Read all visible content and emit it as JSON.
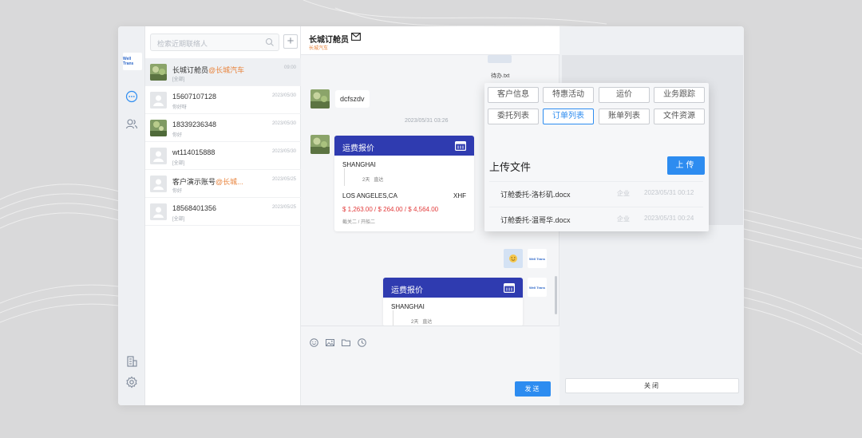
{
  "sidebar": {
    "logo_text": "Well Trans",
    "icons": [
      "chat-icon",
      "contacts-icon",
      "building-icon",
      "settings-icon"
    ]
  },
  "contacts": {
    "search_placeholder": "检索近期联络人",
    "add_label": "+",
    "items": [
      {
        "name": "长城订舱员",
        "org": "@长城汽车",
        "sub": "[全部]",
        "time": "09:00",
        "active": true,
        "photo": true
      },
      {
        "name": "15607107128",
        "org": "",
        "sub": "你好呀",
        "time": "2023/05/30",
        "active": false,
        "photo": false
      },
      {
        "name": "18339236348",
        "org": "",
        "sub": "你好",
        "time": "2023/05/30",
        "active": false,
        "photo": true
      },
      {
        "name": "wt114015888",
        "org": "",
        "sub": "[全部]",
        "time": "2023/05/30",
        "active": false,
        "photo": false
      },
      {
        "name": "客户演示账号",
        "org": "@长城...",
        "sub": "你好",
        "time": "2023/05/25",
        "active": false,
        "photo": false
      },
      {
        "name": "18568401356",
        "org": "",
        "sub": "[全部]",
        "time": "2023/05/25",
        "active": false,
        "photo": false
      }
    ]
  },
  "chat": {
    "title": "长城订舱员",
    "org": "长城汽车",
    "file_name": "待办.txt",
    "text_message": "dcfszdv",
    "timestamp": "2023/05/31 03:26",
    "quote1": {
      "header": "运费报价",
      "pol": "SHANGHAI",
      "transit": "2天",
      "route": "直达",
      "pod": "LOS ANGELES,CA",
      "carrier": "XHF",
      "prices": "$ 1,263.00 / $ 264.00 / $ 4,564.00",
      "footer": "截关二 / 开船二"
    },
    "quote2": {
      "header": "运费报价",
      "pol": "SHANGHAI",
      "transit": "2天",
      "route": "直达"
    },
    "send_label": "发送",
    "toolbar_icons": [
      "emoji-icon",
      "image-icon",
      "folder-icon",
      "history-icon"
    ]
  },
  "popup": {
    "tabs": [
      "客户信息",
      "特惠活动",
      "运价",
      "业务跟踪",
      "委托列表",
      "订单列表",
      "账单列表",
      "文件资源"
    ],
    "active_tab": "订单列表",
    "upload_label": "上传文件",
    "upload_button": "上传",
    "files": [
      {
        "name": "订舱委托-洛杉矶.docx",
        "owner": "企业",
        "time": "2023/05/31 00:12"
      },
      {
        "name": "订舱委托-温哥华.docx",
        "owner": "企业",
        "time": "2023/05/31 00:24"
      }
    ]
  },
  "panel": {
    "close_label": "关闭"
  },
  "colors": {
    "accent": "#2d8cf0",
    "quote_header": "#2f3bb0",
    "org_orange": "#e8823a",
    "price_red": "#e23b3b"
  }
}
